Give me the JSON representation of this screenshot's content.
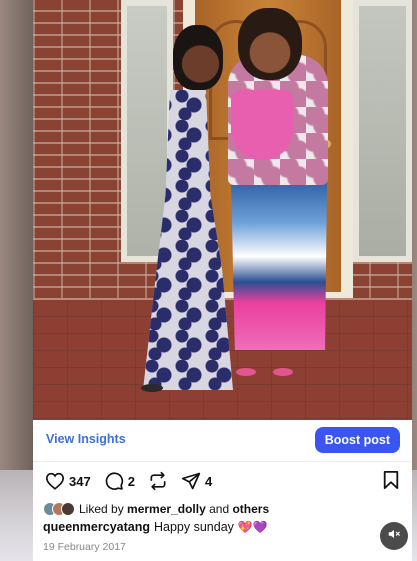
{
  "post": {
    "view_insights_label": "View Insights",
    "boost_label": "Boost post",
    "likes_count": "347",
    "comments_count": "2",
    "shares_count": "4",
    "liked_by_prefix": "Liked by",
    "liked_by_user": "mermer_dolly",
    "liked_by_and": "and",
    "liked_by_others": "others",
    "caption_user": "queenmercyatang",
    "caption_text": "Happy sunday",
    "caption_emoji": "💖💜",
    "date": "19 February 2017"
  },
  "colors": {
    "accent_blue": "#3b55f2",
    "link_blue": "#3f6fd8"
  },
  "icons": {
    "like": "heart-icon",
    "comment": "comment-icon",
    "repost": "repost-icon",
    "share": "send-icon",
    "save": "bookmark-icon",
    "mute": "speaker-muted-icon"
  }
}
